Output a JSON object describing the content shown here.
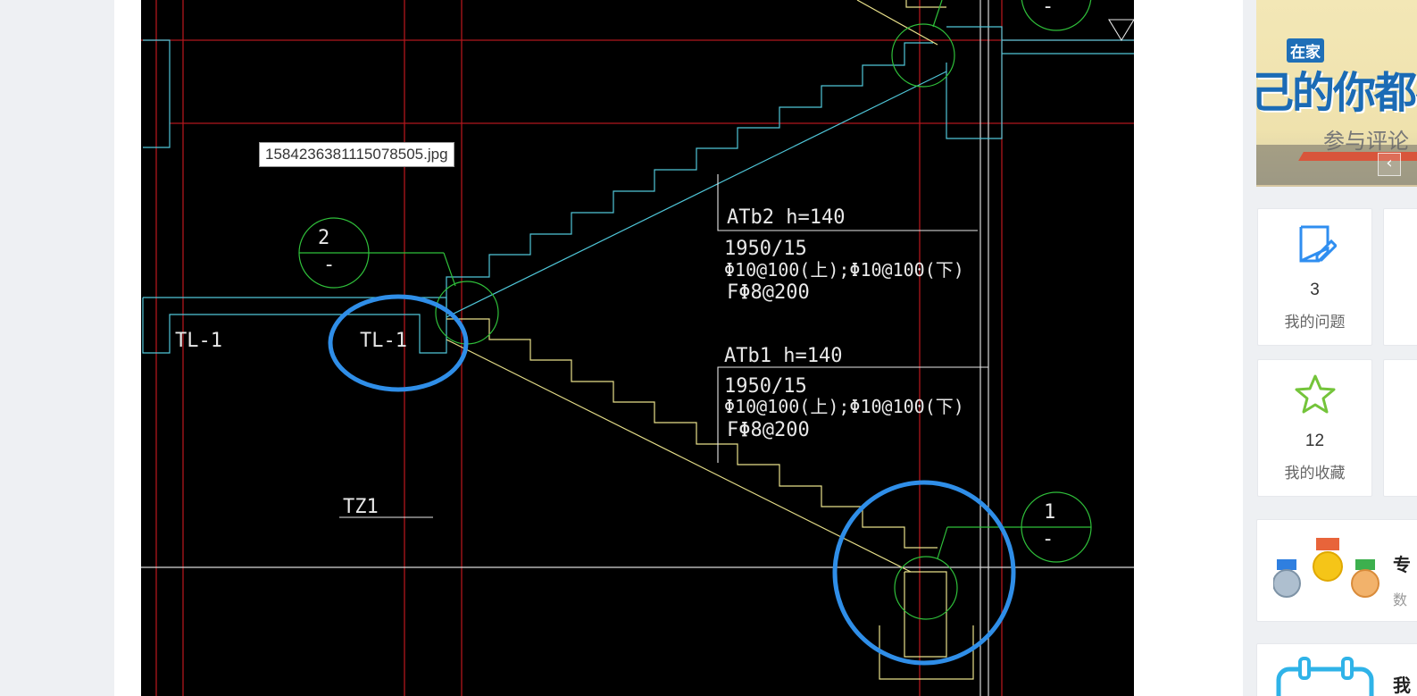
{
  "post_image": {
    "filename": "1584236381115078505.jpg",
    "drawing_labels": {
      "atb2_title": "ATb2 h=140",
      "atb2_line1": "1950/15",
      "atb2_line2": "Φ10@100(上);Φ10@100(下)",
      "atb2_line3": "FΦ8@200",
      "atb1_title": "ATb1 h=140",
      "atb1_line1": "1950/15",
      "atb1_line2": "Φ10@100(上);Φ10@100(下)",
      "atb1_line3": "FΦ8@200",
      "tl_left": "TL-1",
      "tl_circled": "TL-1",
      "tz1": "TZ1",
      "axis_2_number": "2",
      "axis_2_sub": "-",
      "axis_1_number": "1",
      "axis_1_sub": "-",
      "axis_top_sub": "-"
    }
  },
  "sidebar": {
    "banner": {
      "tag": "在家",
      "headline": "己的你都在",
      "subtitle": "参与评论",
      "prev_arrow": "‹"
    },
    "stats": [
      {
        "icon": "edit-note-icon",
        "count": "3",
        "label": "我的问题"
      },
      {
        "icon": "star-icon",
        "count": "12",
        "label": "我的收藏"
      }
    ],
    "ranking_card": {
      "title": "专",
      "subtitle": "数"
    },
    "calendar_card": {
      "title": "我"
    }
  },
  "colors": {
    "cad_background": "#000000",
    "cad_red": "#b0171d",
    "cad_cyan": "#4fc6d8",
    "cad_yellow": "#e8e08a",
    "cad_green": "#2fbf3a",
    "annotation_blue": "#2f8ee8",
    "icon_blue": "#2f8ef0",
    "icon_green": "#74c43a"
  }
}
